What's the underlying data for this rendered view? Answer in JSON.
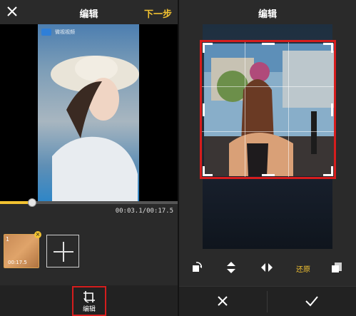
{
  "left": {
    "title": "编辑",
    "next_step_label": "下一步",
    "preview_watermark": "微视视频",
    "timecode": "00:03.1/00:17.5",
    "playback_progress": 0.18,
    "clip": {
      "index": "1",
      "duration": "00:17.5"
    },
    "edit_tool_label": "编辑"
  },
  "right": {
    "title": "编辑",
    "restore_label": "还原"
  },
  "colors": {
    "accent": "#f2c231",
    "highlight": "#d51d1d",
    "background": "#2a2a2a"
  },
  "icons": [
    "close-icon",
    "crop-rotate-icon",
    "rotate-icon",
    "flip-vertical-icon",
    "flip-horizontal-icon",
    "aspect-ratio-icon",
    "cancel-icon",
    "confirm-icon",
    "plus-icon"
  ]
}
